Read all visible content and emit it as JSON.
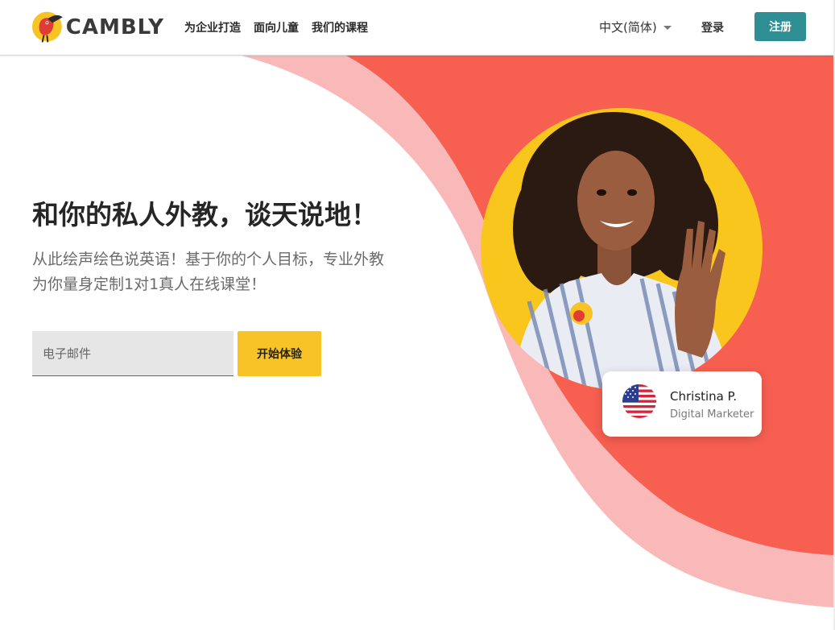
{
  "header": {
    "brand": "CAMBLY",
    "nav": [
      "为企业打造",
      "面向儿童",
      "我们的课程"
    ],
    "language": "中文(简体)",
    "login_label": "登录",
    "signup_label": "注册"
  },
  "hero": {
    "headline": "和你的私人外教，谈天说地！",
    "subtext": "从此绘声绘色说英语！基于你的个人目标，专业外教为你量身定制1对1真人在线课堂！",
    "email_placeholder": "电子邮件",
    "cta_label": "开始体验"
  },
  "tutor": {
    "name": "Christina P.",
    "role": "Digital Marketer",
    "flag_icon": "us-flag-icon"
  },
  "colors": {
    "brand_teal": "#2e8e94",
    "cta_yellow": "#f7c325",
    "coral": "#f75e50",
    "pink": "#f9b8b8",
    "portrait_yellow": "#f9c61d"
  }
}
